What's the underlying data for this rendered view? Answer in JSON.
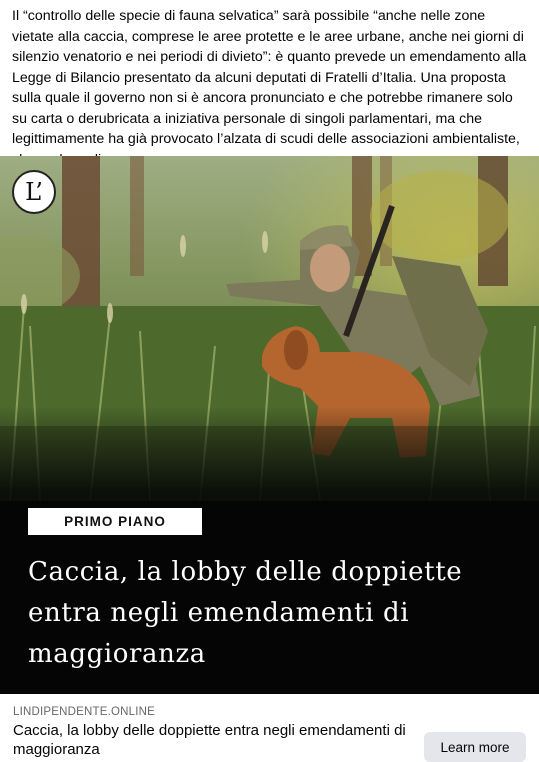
{
  "post": {
    "text": "Il “controllo delle specie di fauna selvatica” sarà possibile “anche nelle zone vietate alla caccia, comprese le aree protette e le aree urbane, anche nei giorni di silenzio venatorio e nei periodi di divieto”: è quanto prevede un emendamento alla Legge di Bilancio presentato da alcuni deputati di Fratelli d’Italia. Una proposta sulla quale il governo non si è ancora pronunciato e che potrebbe rimanere solo su carta o derubricata a iniziativa personale di singoli parlamentari, ma che legittimamente ha già provocato l’alzata di scudi delle associazioni ambientaliste, che parlano di..."
  },
  "hero": {
    "logo_text": "L’",
    "badge": "PRIMO PIANO",
    "headline": "Caccia, la lobby delle doppiette entra negli emendamenti di maggioranza"
  },
  "link": {
    "domain": "LINDIPENDENTE.ONLINE",
    "title": "Caccia, la lobby delle doppiette entra negli emendamenti di maggioranza",
    "cta": "Learn more"
  },
  "icons": {
    "logo": "lindipendente-logo"
  }
}
